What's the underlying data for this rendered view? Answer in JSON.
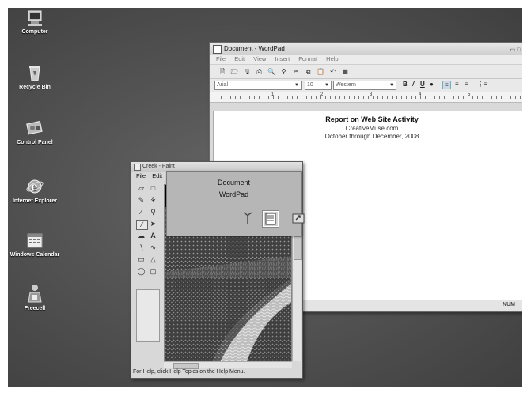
{
  "desktop": {
    "icons": [
      {
        "label": "Computer",
        "icon": "computer-icon"
      },
      {
        "label": "Recycle Bin",
        "icon": "recycle-bin-icon"
      },
      {
        "label": "Control Panel",
        "icon": "control-panel-icon"
      },
      {
        "label": "Internet Explorer",
        "icon": "internet-explorer-icon"
      },
      {
        "label": "Windows Calendar",
        "icon": "calendar-icon"
      },
      {
        "label": "Freecell",
        "icon": "freecell-icon"
      }
    ]
  },
  "wordpad": {
    "title": "Document - WordPad",
    "menu": [
      "File",
      "Edit",
      "View",
      "Insert",
      "Format",
      "Help"
    ],
    "font": "Arial",
    "size": "10",
    "script": "Western",
    "ruler_numbers": [
      "1",
      "2",
      "3",
      "4",
      "5"
    ],
    "doc_lines": [
      "Report on Web Site Activity",
      "CreativeMuse.com",
      "October through December, 2008"
    ],
    "status": "NUM"
  },
  "paint": {
    "title": "Creek - Paint",
    "menu": [
      "File",
      "Edit"
    ],
    "status": "For Help, click Help Topics on the Help Menu."
  },
  "switcher": {
    "line1": "Document",
    "line2": "WordPad"
  }
}
